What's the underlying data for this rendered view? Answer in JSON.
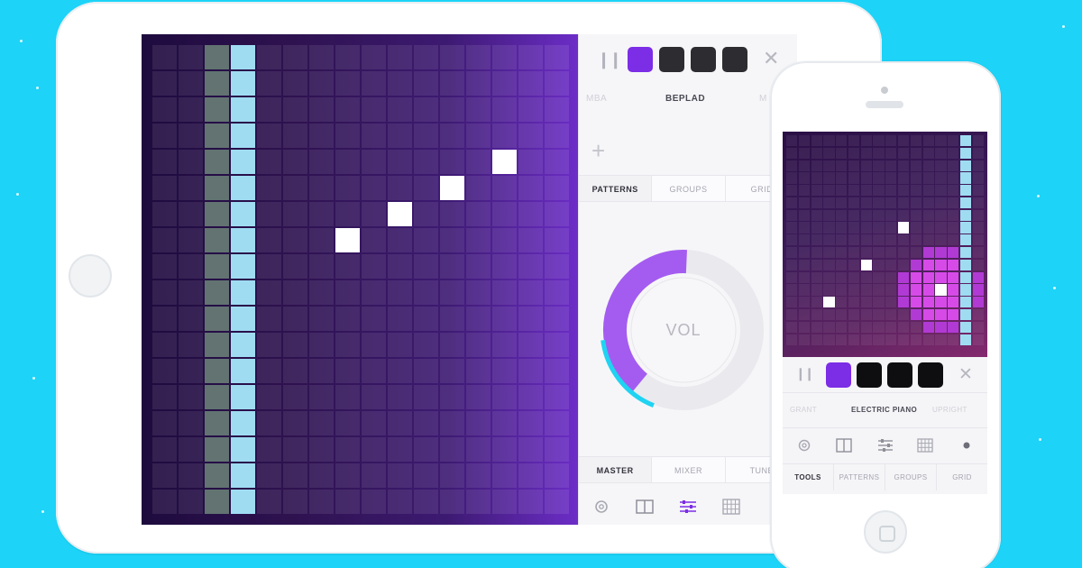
{
  "colors": {
    "background": "#1dd3f7",
    "accent_purple": "#7c2de6",
    "cyan_column": "#9fdcf2",
    "volume_arc": "#a45cf0",
    "volume_arc_cyan": "#1fd3f2"
  },
  "tablet": {
    "grid": {
      "columns": 16,
      "rows": 18,
      "highlighted_columns": [
        {
          "col": 2,
          "style": "gray"
        },
        {
          "col": 3,
          "style": "blue"
        }
      ],
      "active_cells": [
        {
          "col": 7,
          "row": 7
        },
        {
          "col": 9,
          "row": 6
        },
        {
          "col": 11,
          "row": 5
        },
        {
          "col": 13,
          "row": 4
        }
      ]
    },
    "controls": {
      "pause_icon": "pause-icon",
      "swatches": [
        {
          "active": true
        },
        {
          "active": false
        },
        {
          "active": false
        },
        {
          "active": false
        }
      ],
      "close_icon": "close-icon"
    },
    "instruments": {
      "left": "MBA",
      "selected": "BEPLAD",
      "right": "M"
    },
    "add_icon": "plus-icon",
    "tabs": [
      {
        "label": "PATTERNS",
        "active": true
      },
      {
        "label": "GROUPS",
        "active": false
      },
      {
        "label": "GRID",
        "active": false
      }
    ],
    "volume": {
      "label": "VOL",
      "level": 0.55
    },
    "bottom_tabs": [
      {
        "label": "MASTER",
        "active": true
      },
      {
        "label": "MIXER",
        "active": false
      },
      {
        "label": "TUNE",
        "active": false
      }
    ],
    "tool_icons": [
      "gear-icon",
      "book-icon",
      "sliders-icon",
      "grid-icon"
    ]
  },
  "phone": {
    "grid": {
      "columns": 16,
      "rows": 17
    },
    "controls": {
      "pause_icon": "pause-icon",
      "close_icon": "close-icon"
    },
    "instruments": {
      "left": "GRANT",
      "selected": "ELECTRIC PIANO",
      "right": "UPRIGHT"
    },
    "tool_icons": [
      "gear-icon",
      "book-icon",
      "sliders-icon",
      "grid-icon",
      "dot-icon"
    ],
    "tabs": [
      {
        "label": "TOOLS",
        "active": true
      },
      {
        "label": "PATTERNS",
        "active": false
      },
      {
        "label": "GROUPS",
        "active": false
      },
      {
        "label": "GRID",
        "active": false
      }
    ]
  }
}
